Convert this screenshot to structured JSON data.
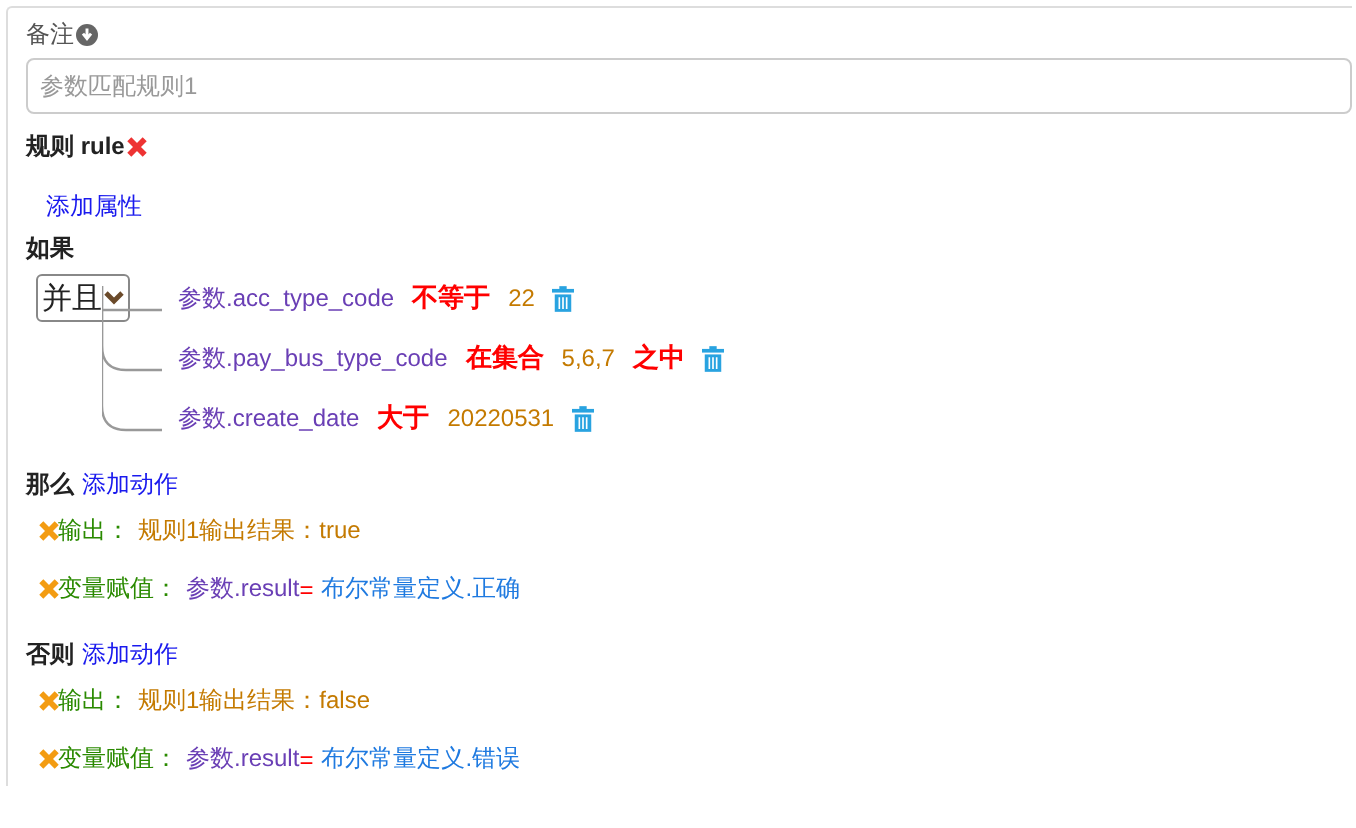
{
  "remark": {
    "label": "备注",
    "placeholder": "参数匹配规则1"
  },
  "rule": {
    "title": "规则 rule",
    "add_property": "添加属性"
  },
  "if": {
    "label": "如果",
    "joiner": "并且",
    "conditions": [
      {
        "left": "参数.acc_type_code",
        "operator": "不等于",
        "value": "22"
      },
      {
        "left": "参数.pay_bus_type_code",
        "operator": "在集合",
        "value": "5,6,7",
        "suffix": "之中"
      },
      {
        "left": "参数.create_date",
        "operator": "大于",
        "value": "20220531"
      }
    ]
  },
  "then": {
    "label": "那么",
    "add_action": "添加动作",
    "actions": [
      {
        "kind": "output",
        "label": "输出：",
        "text": "规则1输出结果：true"
      },
      {
        "kind": "assign",
        "label": "变量赋值：",
        "variable": "参数.result",
        "equals": "=",
        "value": "布尔常量定义.正确"
      }
    ]
  },
  "else": {
    "label": "否则",
    "add_action": "添加动作",
    "actions": [
      {
        "kind": "output",
        "label": "输出：",
        "text": "规则1输出结果：false"
      },
      {
        "kind": "assign",
        "label": "变量赋值：",
        "variable": "参数.result",
        "equals": "=",
        "value": "布尔常量定义.错误"
      }
    ]
  }
}
